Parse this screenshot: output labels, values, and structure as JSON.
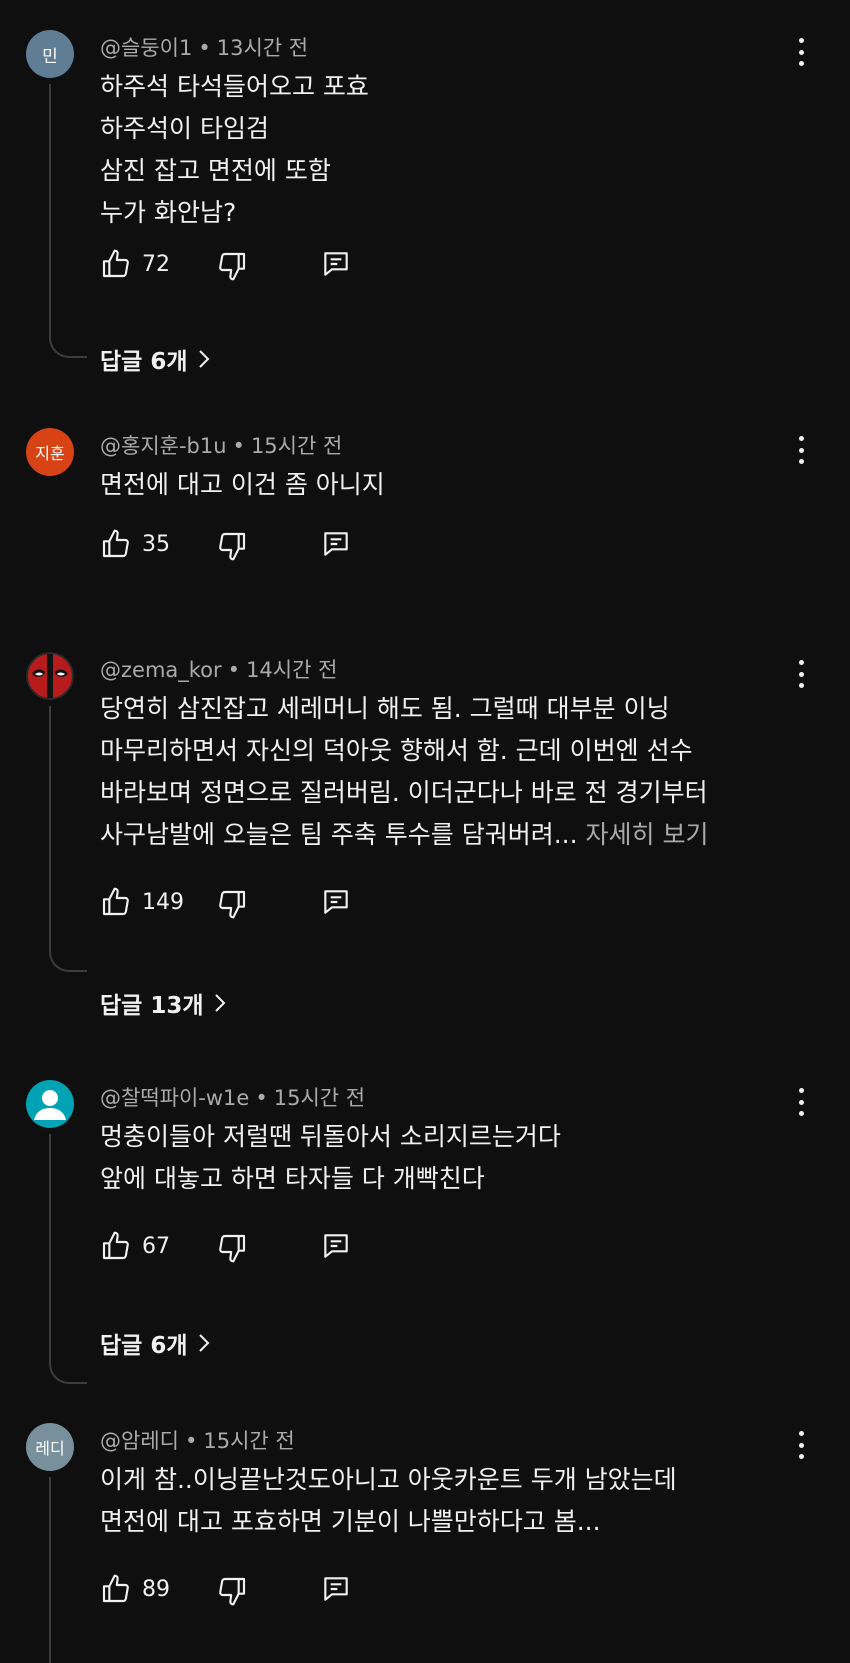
{
  "comments": [
    {
      "avatar_text": "민",
      "avatar_color": "#5f7d95",
      "author": "@슬둥이1",
      "time": "13시간 전",
      "lines": [
        "하주석 타석들어오고 포효",
        "하주석이 타임검",
        "삼진 잡고 면전에 또함",
        "누가 화안남?"
      ],
      "likes": "72",
      "replies": "답글 6개"
    },
    {
      "avatar_text": "지훈",
      "avatar_color": "#d84315",
      "author": "@홍지훈-b1u",
      "time": "15시간 전",
      "lines": [
        "면전에 대고 이건 좀 아니지"
      ],
      "likes": "35",
      "replies": ""
    },
    {
      "avatar_text": "",
      "avatar_icon": "deadpool-mask-icon",
      "avatar_color": "#000000",
      "author": "@zema_kor",
      "time": "14시간 전",
      "lines": [
        "당연히 삼진잡고 세레머니 해도 됨. 그럴때 대부분 이닝",
        "마무리하면서  자신의 덕아웃 향해서 함. 근데 이번엔 선수",
        "바라보며 정면으로 질러버림. 이더군다나 바로 전 경기부터",
        "사구남발에 오늘은 팀 주축 투수를 담궈버려..."
      ],
      "more_label": "자세히 보기",
      "likes": "149",
      "replies": "답글 13개"
    },
    {
      "avatar_text": "",
      "avatar_icon": "default-user-icon",
      "avatar_color": "#00a3b4",
      "author": "@찰떡파이-w1e",
      "time": "15시간 전",
      "lines": [
        "멍충이들아 저럴땐 뒤돌아서 소리지르는거다",
        "앞에 대놓고 하면  타자들 다 개빡친다"
      ],
      "likes": "67",
      "replies": "답글 6개"
    },
    {
      "avatar_text": "레디",
      "avatar_color": "#78909c",
      "author": "@암레디",
      "time": "15시간 전",
      "lines": [
        "이게 참..이닝끝난것도아니고 아웃카운트 두개 남았는데",
        "면전에 대고 포효하면 기분이 나쁠만하다고 봄..."
      ],
      "likes": "89",
      "replies": ""
    }
  ],
  "header_separator": "•"
}
